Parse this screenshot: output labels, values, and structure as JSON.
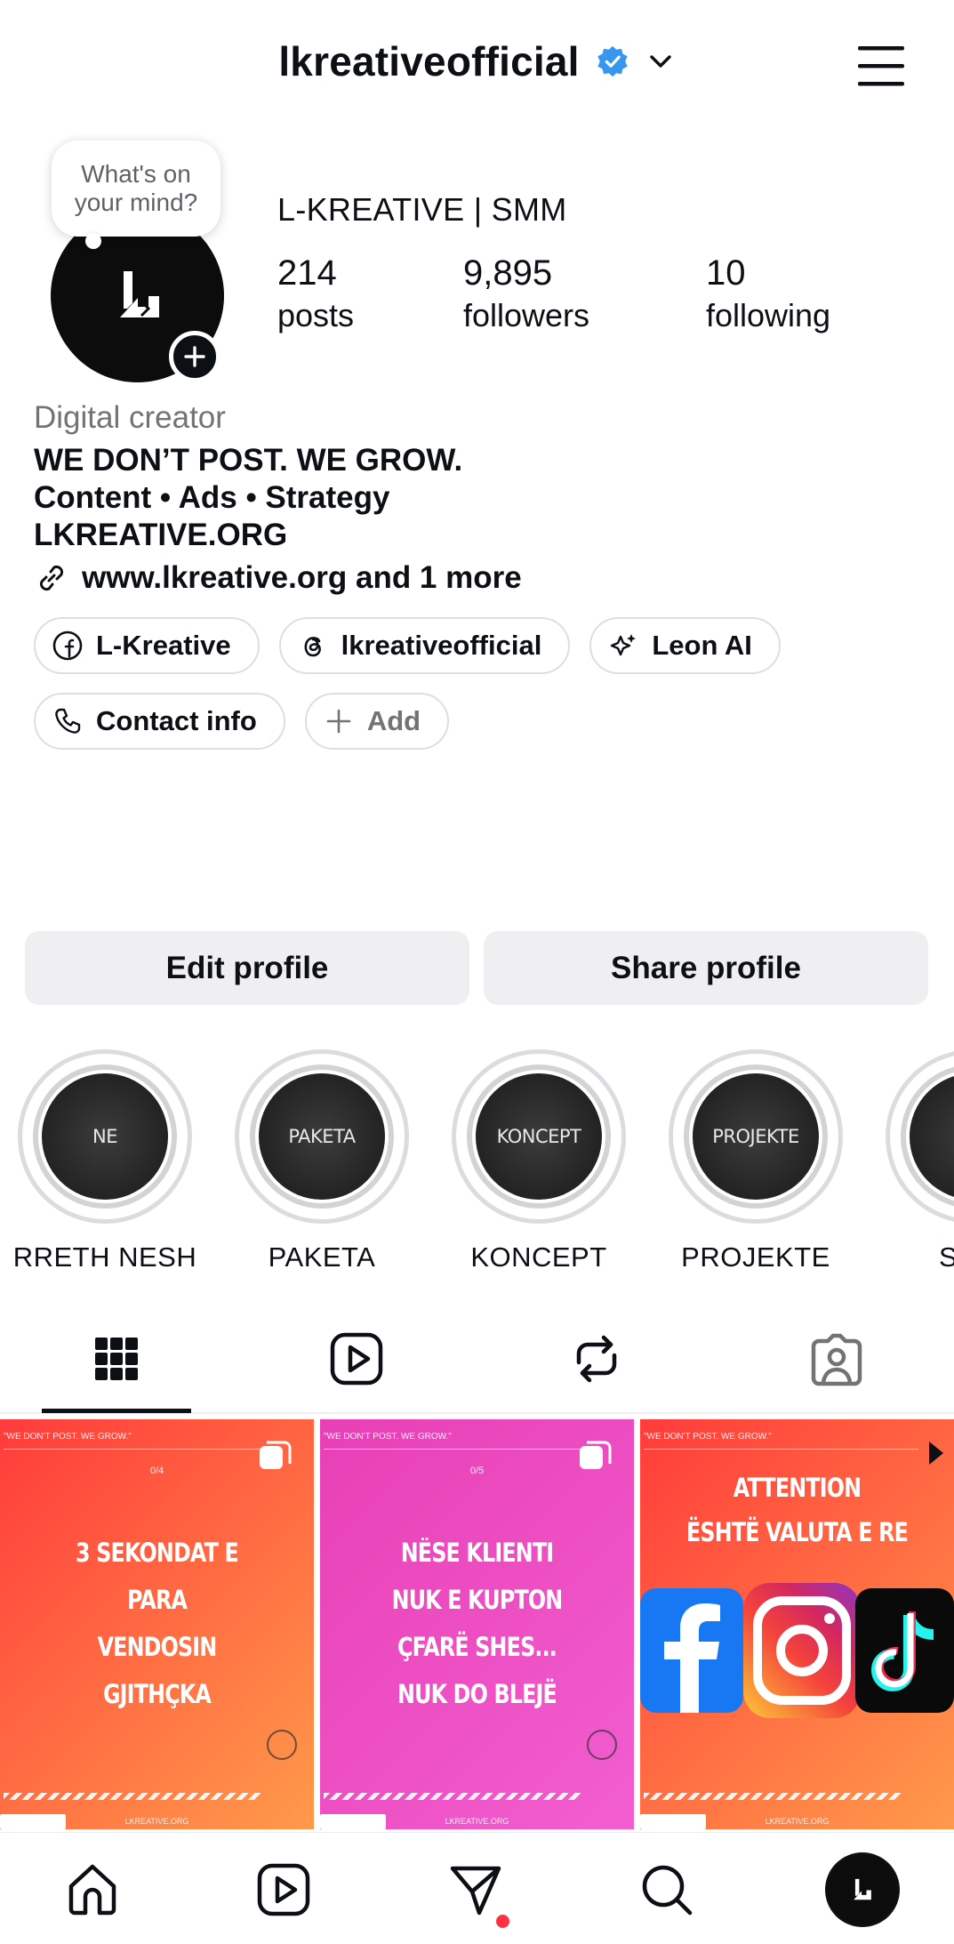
{
  "header": {
    "username": "lkreativeofficial"
  },
  "profile": {
    "note_placeholder": "What's on your mind?",
    "full_name": "L-KREATIVE | SMM",
    "stats": [
      {
        "value": "214",
        "label": "posts"
      },
      {
        "value": "9,895",
        "label": "followers"
      },
      {
        "value": "10",
        "label": "following"
      }
    ],
    "category": "Digital creator",
    "bio_lines": [
      "WE DON’T POST. WE GROW.",
      "Content • Ads • Strategy",
      "LKREATIVE.ORG"
    ],
    "link_text": "www.lkreative.org and 1 more"
  },
  "chips": [
    {
      "label": "L-Kreative",
      "icon": "facebook-icon"
    },
    {
      "label": "lkreativeofficial",
      "icon": "threads-icon"
    },
    {
      "label": "Leon AI",
      "icon": "ai-sparkle-icon"
    },
    {
      "label": "Contact info",
      "icon": "phone-icon"
    },
    {
      "label": "Add",
      "icon": "plus-icon"
    }
  ],
  "actions": {
    "edit_profile": "Edit profile",
    "share_profile": "Share profile"
  },
  "highlights": [
    {
      "cover": "NE",
      "label": "RRETH NESH"
    },
    {
      "cover": "PAKETA",
      "label": "PAKETA"
    },
    {
      "cover": "KONCEPT",
      "label": "KONCEPT"
    },
    {
      "cover": "PROJEKTE",
      "label": "PROJEKTE"
    },
    {
      "cover": "",
      "label": "S"
    }
  ],
  "tabs": [
    "grid-icon",
    "reels-icon",
    "reposts-icon",
    "tagged-icon"
  ],
  "posts": [
    {
      "top_text": "\"WE DON'T POST. WE GROW.\"",
      "counter": "0/4",
      "title_lines": [
        "3 SEKONDAT E PARA",
        "VENDOSIN",
        "GJITHÇKA"
      ],
      "footer_url": "LKREATIVE.ORG",
      "bg_from": "#ff3b3b",
      "bg_to": "#ff9a4a"
    },
    {
      "top_text": "\"WE DON'T POST. WE GROW.\"",
      "counter": "0/5",
      "title_lines": [
        "NËSE KLIENTI",
        "NUK E KUPTON",
        "ÇFARË SHES...",
        "NUK DO BLEJË"
      ],
      "footer_url": "LKREATIVE.ORG",
      "bg_from": "#e83fb5",
      "bg_to": "#f25ed0"
    },
    {
      "top_text": "\"WE DON'T POST. WE GROW.\"",
      "counter": "",
      "title_lines": [
        "ATTENTION",
        "ËSHTË VALUTA E RE"
      ],
      "footer_url": "LKREATIVE.ORG",
      "bg_from": "#ff3b3b",
      "bg_to": "#ff9a4a"
    }
  ],
  "bottom_nav": [
    "home-icon",
    "reels-icon",
    "direct-messages-icon",
    "search-icon",
    "profile-avatar"
  ],
  "colors": {
    "verified": "#3797f0",
    "notification_dot": "#ff3040",
    "button_bg": "#efeff1"
  }
}
